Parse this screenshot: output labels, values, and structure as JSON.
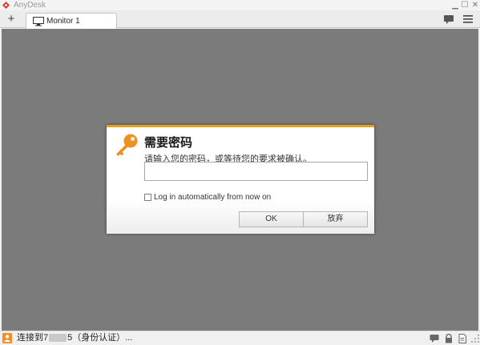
{
  "window": {
    "app_title": "AnyDesk",
    "minimize_glyph": "▁",
    "maximize_glyph": "☐",
    "close_glyph": "✕"
  },
  "tabs": {
    "add_glyph": "+",
    "items": [
      {
        "label": "Monitor 1",
        "icon": "monitor-icon"
      }
    ]
  },
  "toolbar": {
    "icons": [
      "chat-icon",
      "menu-icon"
    ]
  },
  "dialog": {
    "title": "需要密码",
    "message": "请输入您的密码，或等待您的要求被确认。",
    "password_value": "",
    "auto_login_label": "Log in automatically from now on",
    "auto_login_checked": false,
    "ok_label": "OK",
    "cancel_label": "放弃",
    "icon": "key-icon"
  },
  "statusbar": {
    "prefix": "连接到",
    "id_start": "7",
    "id_end": "5",
    "suffix": "（身份认证）...",
    "icons": [
      "chat-icon",
      "lock-icon",
      "document-icon",
      "resize-grip-icon"
    ]
  },
  "colors": {
    "accent": "#e3a21a",
    "logo": "#d83b2a",
    "viewport": "#7b7b7b"
  }
}
